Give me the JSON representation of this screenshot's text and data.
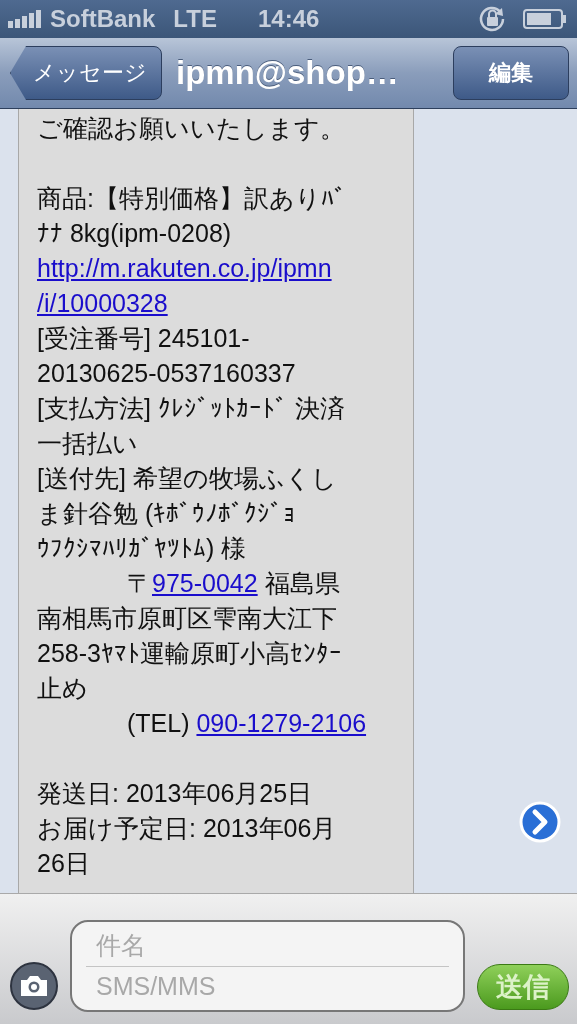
{
  "status_bar": {
    "carrier": "SoftBank",
    "network": "LTE",
    "time": "14:46"
  },
  "nav": {
    "back": "メッセージ",
    "title": "ipmn@shop…",
    "edit": "編集"
  },
  "message": {
    "lines": [
      {
        "kind": "text",
        "segments": [
          {
            "kind": "text",
            "text": "ご確認お願いいたします。"
          }
        ]
      },
      {
        "kind": "gap"
      },
      {
        "kind": "text",
        "segments": [
          {
            "kind": "text",
            "text": "商品:【特別価格】訳ありﾊﾞ"
          }
        ]
      },
      {
        "kind": "text",
        "segments": [
          {
            "kind": "text",
            "text": "ﾅﾅ 8kg(ipm-0208)"
          }
        ]
      },
      {
        "kind": "text",
        "segments": [
          {
            "kind": "link",
            "text": "http://m.rakuten.co.jp/ipmn"
          }
        ]
      },
      {
        "kind": "text",
        "segments": [
          {
            "kind": "link",
            "text": "/i/10000328"
          }
        ]
      },
      {
        "kind": "text",
        "segments": [
          {
            "kind": "text",
            "text": "[受注番号] 245101-"
          }
        ]
      },
      {
        "kind": "text",
        "segments": [
          {
            "kind": "text",
            "text": "20130625-0537160337"
          }
        ]
      },
      {
        "kind": "text",
        "segments": [
          {
            "kind": "text",
            "text": "[支払方法] ｸﾚｼﾞｯﾄｶｰﾄﾞ 決済"
          }
        ]
      },
      {
        "kind": "text",
        "segments": [
          {
            "kind": "text",
            "text": "一括払い"
          }
        ]
      },
      {
        "kind": "text",
        "segments": [
          {
            "kind": "text",
            "text": "[送付先] 希望の牧場ふくし"
          }
        ]
      },
      {
        "kind": "text",
        "segments": [
          {
            "kind": "text",
            "text": "ま針谷勉 (ｷﾎﾞｳﾉﾎﾞｸｼﾞｮ"
          }
        ]
      },
      {
        "kind": "text",
        "segments": [
          {
            "kind": "text",
            "text": "ｳﾌｸｼﾏﾊﾘｶﾞﾔﾂﾄﾑ) 様"
          }
        ]
      },
      {
        "kind": "text",
        "indented": true,
        "segments": [
          {
            "kind": "text",
            "text": "〒"
          },
          {
            "kind": "link",
            "text": "975-0042"
          },
          {
            "kind": "text",
            "text": " 福島県"
          }
        ]
      },
      {
        "kind": "text",
        "segments": [
          {
            "kind": "text",
            "text": "南相馬市原町区雫南大江下"
          }
        ]
      },
      {
        "kind": "text",
        "segments": [
          {
            "kind": "text",
            "text": "258-3ﾔﾏﾄ運輸原町小高ｾﾝﾀｰ"
          }
        ]
      },
      {
        "kind": "text",
        "segments": [
          {
            "kind": "text",
            "text": "止め"
          }
        ]
      },
      {
        "kind": "text",
        "indented": true,
        "segments": [
          {
            "kind": "text",
            "text": "(TEL) "
          },
          {
            "kind": "link",
            "text": "090-1279-2106"
          }
        ]
      },
      {
        "kind": "gap"
      },
      {
        "kind": "text",
        "segments": [
          {
            "kind": "text",
            "text": "発送日: 2013年06月25日"
          }
        ]
      },
      {
        "kind": "text",
        "segments": [
          {
            "kind": "text",
            "text": "お届け予定日: 2013年06月"
          }
        ]
      },
      {
        "kind": "text",
        "segments": [
          {
            "kind": "text",
            "text": "26日"
          }
        ]
      }
    ]
  },
  "compose": {
    "subject_placeholder": "件名",
    "body_placeholder": "SMS/MMS",
    "send": "送信"
  }
}
